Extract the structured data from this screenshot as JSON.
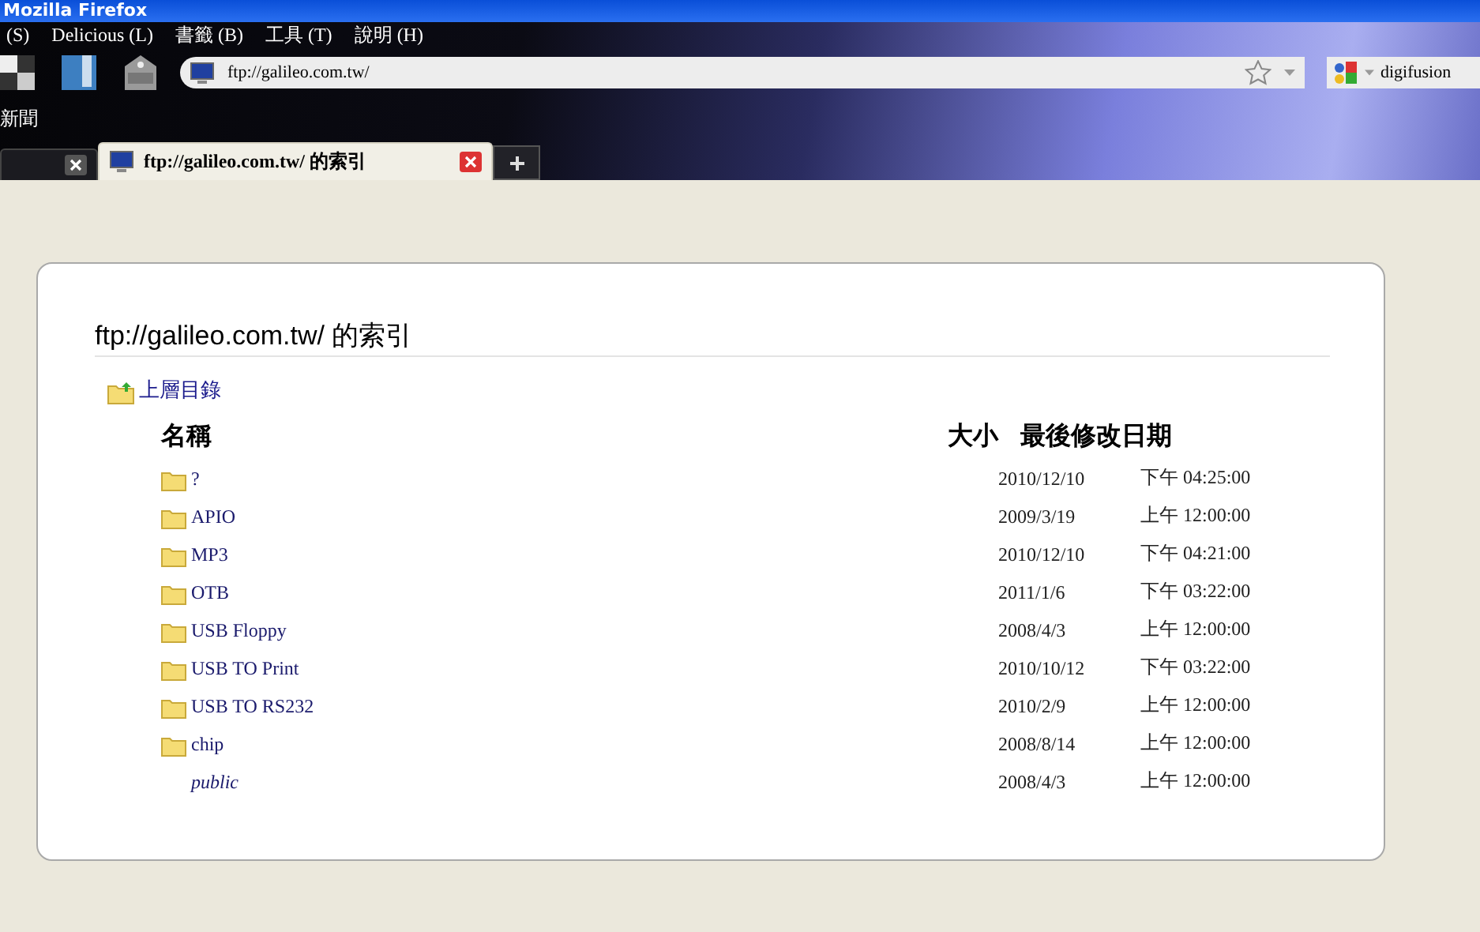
{
  "window": {
    "title": "Mozilla Firefox"
  },
  "menu": [
    {
      "label": "(S)"
    },
    {
      "label": "Delicious (L)"
    },
    {
      "label": "書籤 (B)"
    },
    {
      "label": "工具 (T)"
    },
    {
      "label": "說明 (H)"
    }
  ],
  "address_bar": {
    "value": "ftp://galileo.com.tw/"
  },
  "search_bar": {
    "value": "digifusion"
  },
  "bookmarks": [
    {
      "label": "新聞"
    }
  ],
  "tabs": [
    {
      "selected": false
    },
    {
      "label": "ftp://galileo.com.tw/ 的索引",
      "selected": true
    }
  ],
  "page": {
    "heading": "ftp://galileo.com.tw/ 的索引",
    "parent_link": "上層目錄",
    "columns": [
      "名稱",
      "大小",
      "最後修改日期"
    ],
    "rows": [
      {
        "kind": "folder",
        "name": "?",
        "date": "2010/12/10",
        "time": "下午 04:25:00"
      },
      {
        "kind": "folder",
        "name": "APIO",
        "date": "2009/3/19",
        "time": "上午 12:00:00"
      },
      {
        "kind": "folder",
        "name": "MP3",
        "date": "2010/12/10",
        "time": "下午 04:21:00"
      },
      {
        "kind": "folder",
        "name": "OTB",
        "date": "2011/1/6",
        "time": "下午 03:22:00"
      },
      {
        "kind": "folder",
        "name": "USB Floppy",
        "date": "2008/4/3",
        "time": "上午 12:00:00"
      },
      {
        "kind": "folder",
        "name": "USB TO Print",
        "date": "2010/10/12",
        "time": "下午 03:22:00"
      },
      {
        "kind": "folder",
        "name": "USB TO RS232",
        "date": "2010/2/9",
        "time": "上午 12:00:00"
      },
      {
        "kind": "folder",
        "name": "chip",
        "date": "2008/8/14",
        "time": "上午 12:00:00"
      },
      {
        "kind": "link",
        "name": "public",
        "date": "2008/4/3",
        "time": "上午 12:00:00"
      }
    ]
  }
}
